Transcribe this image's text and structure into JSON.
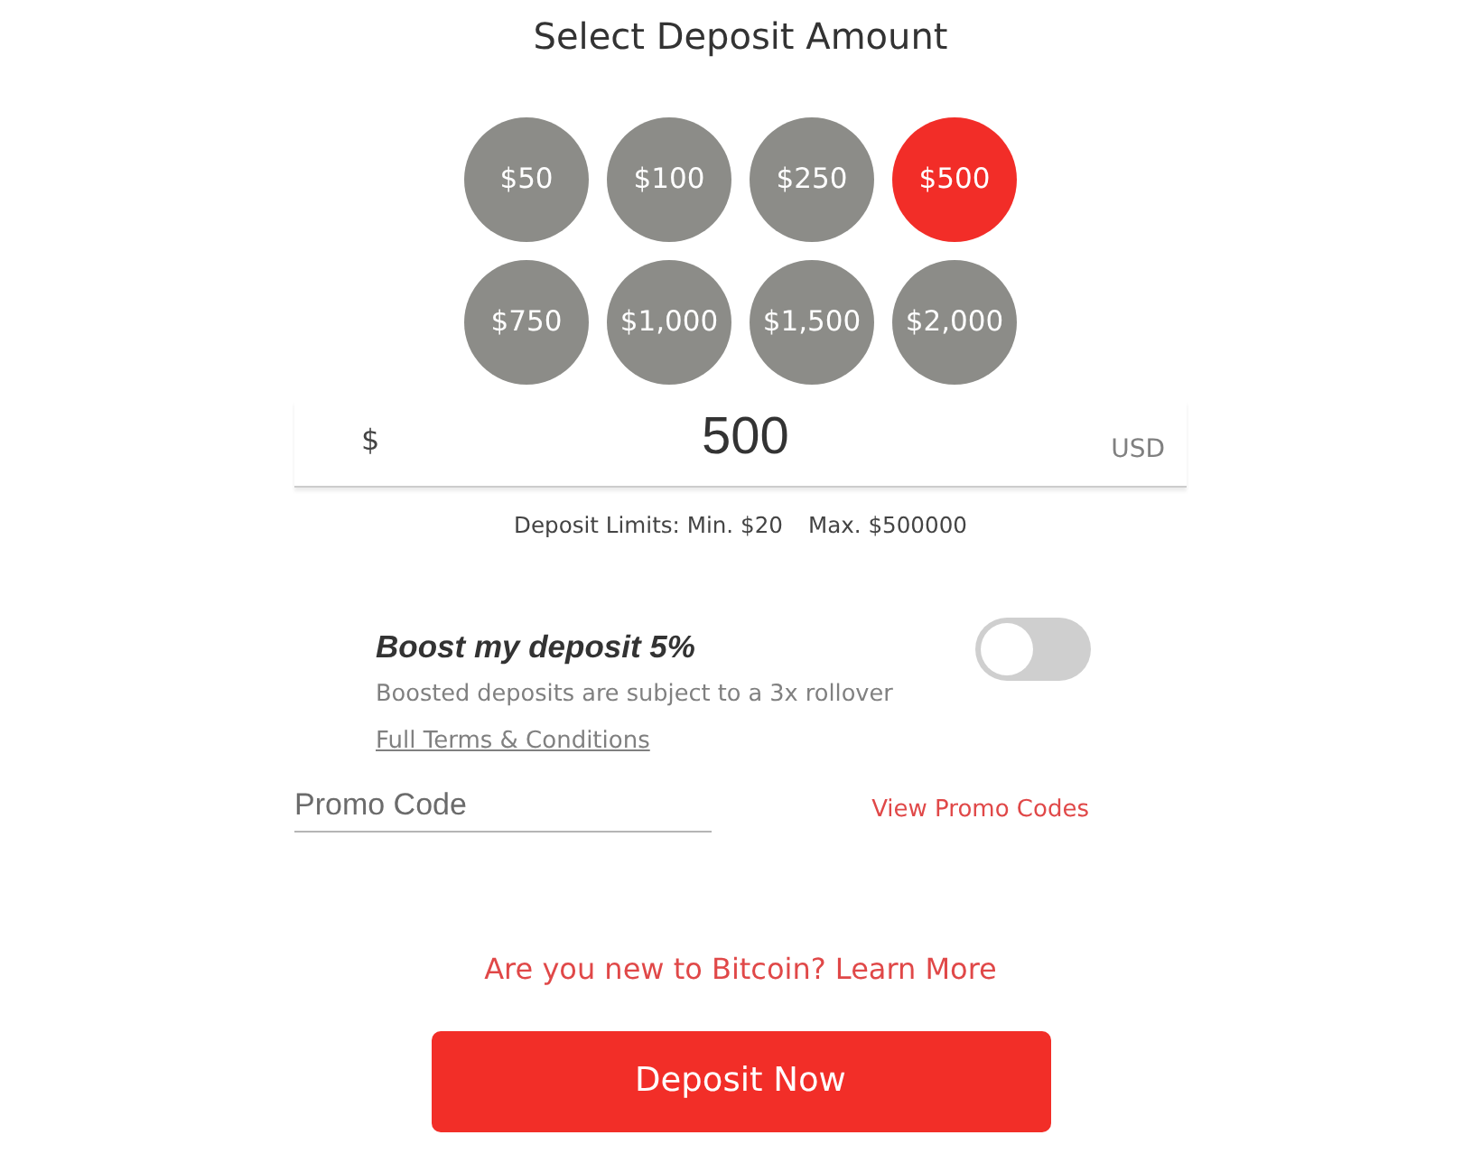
{
  "title": "Select Deposit Amount",
  "amounts": [
    {
      "label": "$50",
      "selected": false
    },
    {
      "label": "$100",
      "selected": false
    },
    {
      "label": "$250",
      "selected": false
    },
    {
      "label": "$500",
      "selected": true
    },
    {
      "label": "$750",
      "selected": false
    },
    {
      "label": "$1,000",
      "selected": false
    },
    {
      "label": "$1,500",
      "selected": false
    },
    {
      "label": "$2,000",
      "selected": false
    }
  ],
  "amount_field": {
    "currency_symbol": "$",
    "value": "500",
    "currency": "USD"
  },
  "limits": {
    "min": "Deposit Limits: Min. $20",
    "max": "Max. $500000"
  },
  "boost": {
    "title": "Boost my deposit 5%",
    "note": "Boosted deposits are subject to a 3x rollover",
    "terms_link": "Full Terms & Conditions",
    "on": false
  },
  "promo": {
    "placeholder": "Promo Code",
    "link": "View Promo Codes"
  },
  "bitcoin_link": "Are you new to Bitcoin? Learn More",
  "deposit_button": "Deposit Now"
}
